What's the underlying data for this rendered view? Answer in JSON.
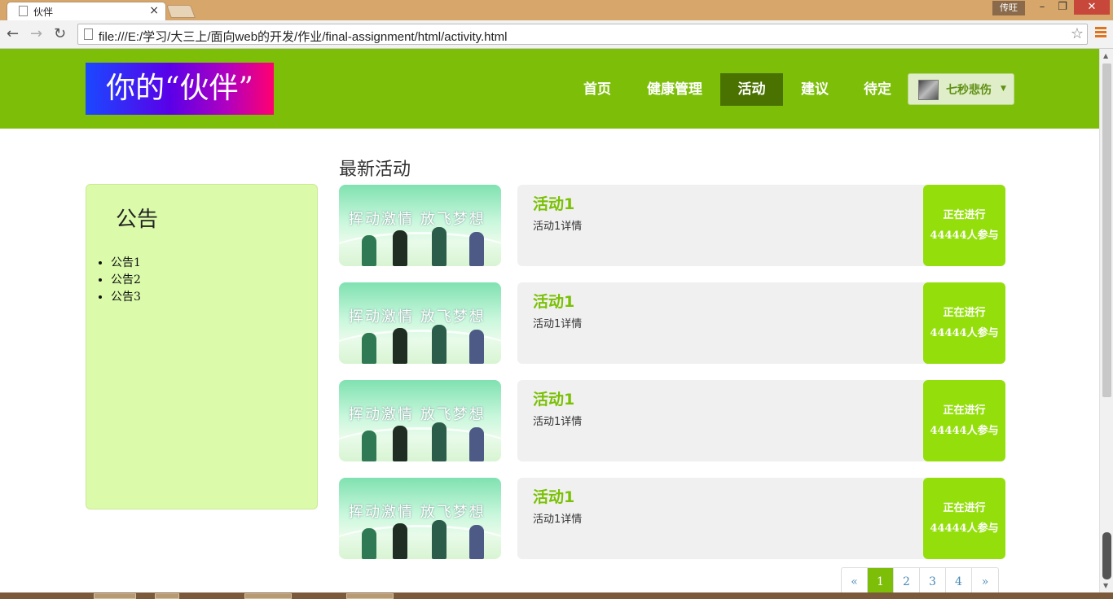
{
  "browser": {
    "tab_title": "伙伴",
    "tab_close": "×",
    "user_badge": "传旺",
    "win_min": "–",
    "win_max": "❐",
    "win_close": "✕",
    "back_icon": "←",
    "forward_icon": "→",
    "reload_icon": "↻",
    "url": "file:///E:/学习/大三上/面向web的开发/作业/final-assignment/html/activity.html",
    "star_icon": "☆"
  },
  "navbar": {
    "logo_text": "你的“伙伴”",
    "items": [
      {
        "label": "首页",
        "active": false
      },
      {
        "label": "健康管理",
        "active": false
      },
      {
        "label": "活动",
        "active": true
      },
      {
        "label": "建议",
        "active": false
      },
      {
        "label": "待定",
        "active": false
      }
    ],
    "user": {
      "name": "七秒悲伤",
      "caret": "▼"
    },
    "brand_color": "#7cbe08",
    "active_color": "#4a7200"
  },
  "notice": {
    "title": "公告",
    "items": [
      "公告1",
      "公告2",
      "公告3"
    ]
  },
  "main": {
    "section_title": "最新活动",
    "image_banner_text": "挥动激情  放飞梦想",
    "activities": [
      {
        "title": "活动1",
        "desc": "活动1详情",
        "status": "正在进行",
        "count": "44444人参与"
      },
      {
        "title": "活动1",
        "desc": "活动1详情",
        "status": "正在进行",
        "count": "44444人参与"
      },
      {
        "title": "活动1",
        "desc": "活动1详情",
        "status": "正在进行",
        "count": "44444人参与"
      },
      {
        "title": "活动1",
        "desc": "活动1详情",
        "status": "正在进行",
        "count": "44444人参与"
      }
    ],
    "status_color": "#94df0b"
  },
  "pagination": {
    "prev": "«",
    "pages": [
      "1",
      "2",
      "3",
      "4"
    ],
    "current": "1",
    "next": "»"
  }
}
